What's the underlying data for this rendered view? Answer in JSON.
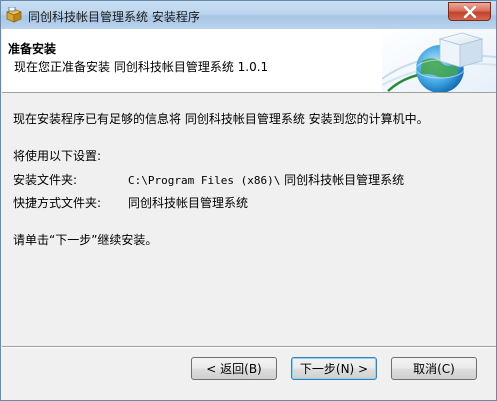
{
  "window": {
    "title": "同创科技帐目管理系统 安装程序",
    "icon": "installer-box-icon",
    "close_icon": "close-icon"
  },
  "header": {
    "title": "准备安装",
    "subtitle": "现在您正准备安装 同创科技帐目管理系统 1.0.1"
  },
  "body": {
    "intro": "现在安装程序已有足够的信息将 同创科技帐目管理系统 安装到您的计算机中。",
    "settings_heading": "将使用以下设置:",
    "settings": [
      {
        "label": "安装文件夹:",
        "value": "C:\\Program Files (x86)\\同创科技帐目管理系统"
      },
      {
        "label": "快捷方式文件夹:",
        "value": "同创科技帐目管理系统"
      }
    ],
    "instruction": "请单击“下一步”继续安装。"
  },
  "buttons": {
    "back": "< 返回(B)",
    "next": "下一步(N) >",
    "cancel": "取消(C)"
  },
  "colors": {
    "titlebar": "#bcd5ee",
    "close_button": "#c2432b",
    "default_button_border": "#3c7fb1"
  }
}
